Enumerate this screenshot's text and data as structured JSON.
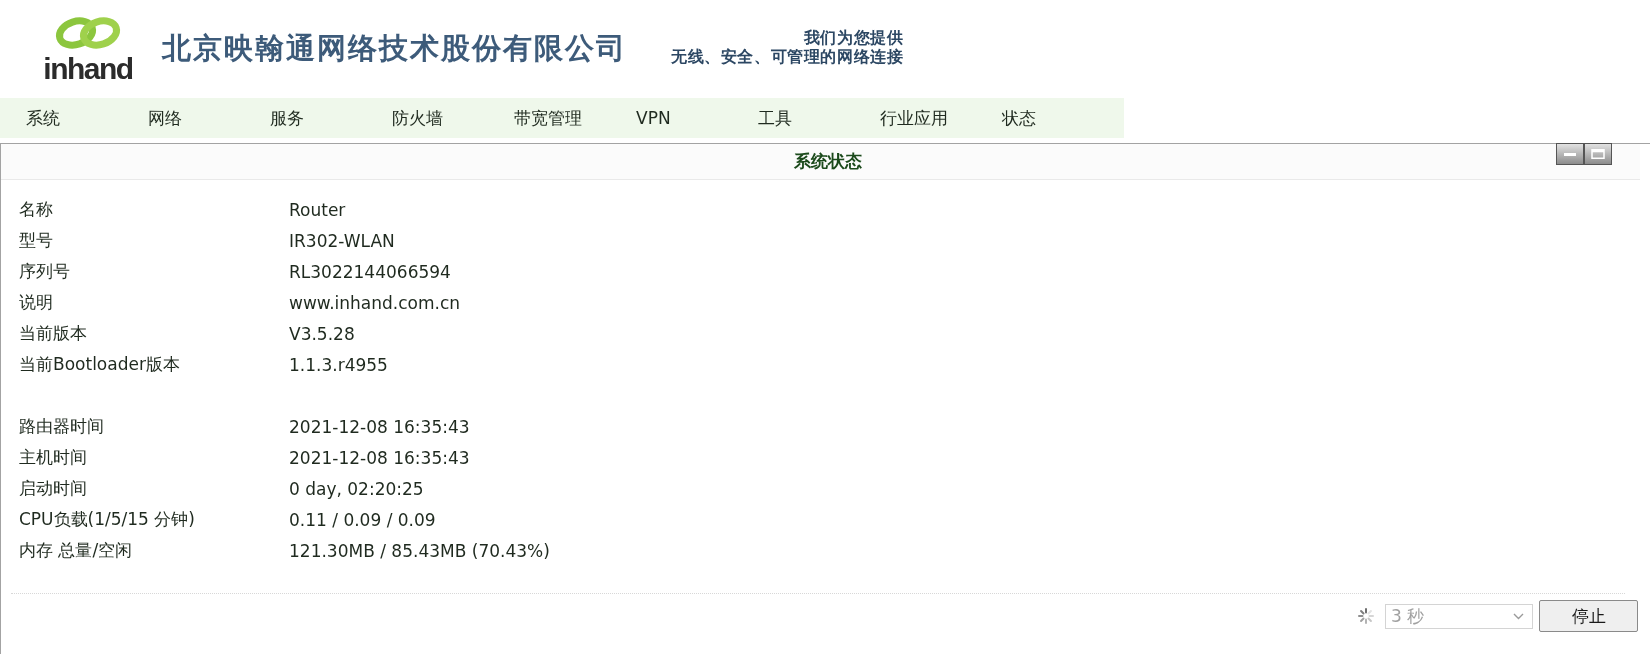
{
  "header": {
    "logo_text": "inhand",
    "company_name": "北京映翰通网络技术股份有限公司",
    "tagline": [
      "我们为您提供",
      "无线、安全、可管理的网络连接"
    ]
  },
  "nav": {
    "items": [
      "系统",
      "网络",
      "服务",
      "防火墙",
      "带宽管理",
      "VPN",
      "工具",
      "行业应用",
      "状态"
    ]
  },
  "panel": {
    "title": "系统状态",
    "info_groups": [
      {
        "rows": [
          {
            "label": "名称",
            "value": "Router"
          },
          {
            "label": "型号",
            "value": "IR302-WLAN"
          },
          {
            "label": "序列号",
            "value": "RL3022144066594"
          },
          {
            "label": "说明",
            "value": "www.inhand.com.cn"
          },
          {
            "label": "当前版本",
            "value": "V3.5.28"
          },
          {
            "label": "当前Bootloader版本",
            "value": "1.1.3.r4955"
          }
        ]
      },
      {
        "rows": [
          {
            "label": "路由器时间",
            "value": "2021-12-08 16:35:43"
          },
          {
            "label": "主机时间",
            "value": "2021-12-08 16:35:43"
          },
          {
            "label": "启动时间",
            "value": "0 day, 02:20:25"
          },
          {
            "label": "CPU负载(1/5/15 分钟)",
            "value": "0.11 / 0.09 / 0.09"
          },
          {
            "label": "内存 总量/空闲",
            "value": "121.30MB / 85.43MB (70.43%)"
          }
        ]
      }
    ]
  },
  "footer": {
    "refresh_interval": {
      "value": "3 秒",
      "disabled": true
    },
    "stop_button": "停止"
  }
}
